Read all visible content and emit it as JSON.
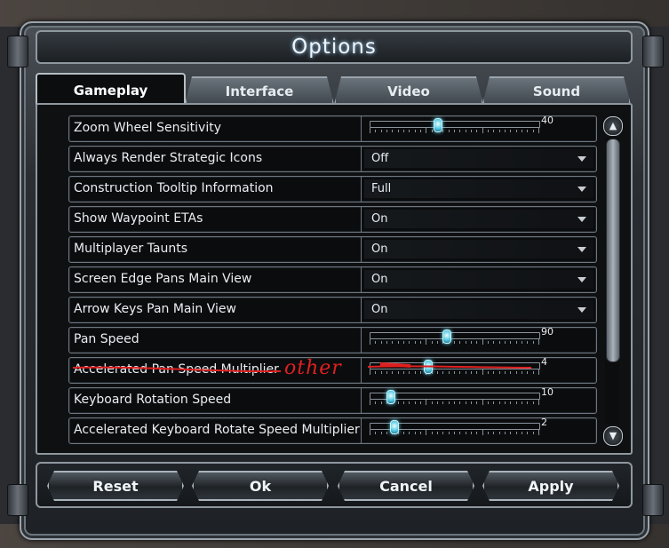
{
  "window": {
    "title": "Options"
  },
  "tabs": [
    {
      "label": "Gameplay",
      "active": true
    },
    {
      "label": "Interface",
      "active": false
    },
    {
      "label": "Video",
      "active": false
    },
    {
      "label": "Sound",
      "active": false
    }
  ],
  "settings": [
    {
      "label": "Zoom Wheel Sensitivity",
      "control": "slider",
      "value": "40",
      "fraction": 0.4
    },
    {
      "label": "Always Render Strategic Icons",
      "control": "dropdown",
      "value": "Off"
    },
    {
      "label": "Construction Tooltip Information",
      "control": "dropdown",
      "value": "Full"
    },
    {
      "label": "Show Waypoint ETAs",
      "control": "dropdown",
      "value": "On"
    },
    {
      "label": "Multiplayer Taunts",
      "control": "dropdown",
      "value": "On"
    },
    {
      "label": "Screen Edge Pans Main View",
      "control": "dropdown",
      "value": "On"
    },
    {
      "label": "Arrow Keys Pan Main View",
      "control": "dropdown",
      "value": "On"
    },
    {
      "label": "Pan Speed",
      "control": "slider",
      "value": "90",
      "fraction": 0.45
    },
    {
      "label": "Accelerated Pan Speed Multiplier",
      "control": "slider",
      "value": "4",
      "fraction": 0.34
    },
    {
      "label": "Keyboard Rotation Speed",
      "control": "slider",
      "value": "10",
      "fraction": 0.12
    },
    {
      "label": "Accelerated Keyboard Rotate Speed Multiplier",
      "control": "slider",
      "value": "2",
      "fraction": 0.14
    }
  ],
  "annotation": {
    "text": "other",
    "color": "#e02020"
  },
  "scrollbar": {
    "up_icon": "chevron-up-icon",
    "down_icon": "chevron-down-icon"
  },
  "buttons": {
    "reset": "Reset",
    "ok": "Ok",
    "cancel": "Cancel",
    "apply": "Apply"
  }
}
